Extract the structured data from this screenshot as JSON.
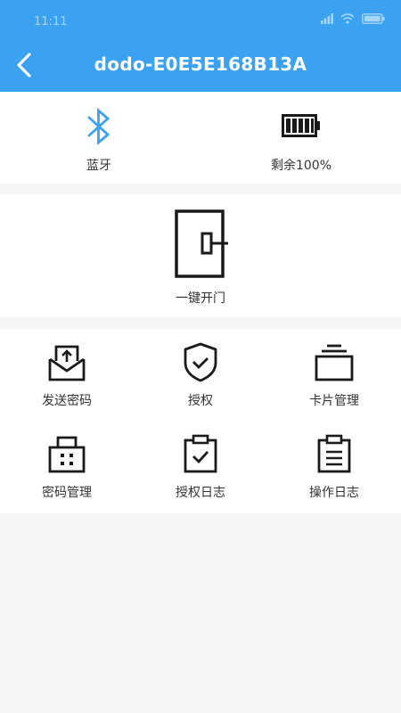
{
  "status_bar": {
    "time": "11:11"
  },
  "header": {
    "title": "dodo-E0E5E168B13A",
    "back_icon": "chevron-left-icon"
  },
  "info": {
    "bluetooth": {
      "label": "蓝牙",
      "icon": "bluetooth-icon"
    },
    "battery": {
      "label": "剩余100%",
      "icon": "battery-icon",
      "level": 1.0
    }
  },
  "unlock": {
    "label": "一键开门",
    "icon": "door-icon"
  },
  "menu": [
    {
      "label": "发送密码",
      "icon": "send-mail-icon"
    },
    {
      "label": "授权",
      "icon": "shield-check-icon"
    },
    {
      "label": "卡片管理",
      "icon": "card-stack-icon"
    },
    {
      "label": "密码管理",
      "icon": "keypad-lock-icon"
    },
    {
      "label": "授权日志",
      "icon": "clipboard-check-icon"
    },
    {
      "label": "操作日志",
      "icon": "clipboard-list-icon"
    }
  ],
  "colors": {
    "header_bg": "#3aa2f0",
    "accent": "#3aa2f0",
    "icon_dark": "#1a1a1a"
  }
}
